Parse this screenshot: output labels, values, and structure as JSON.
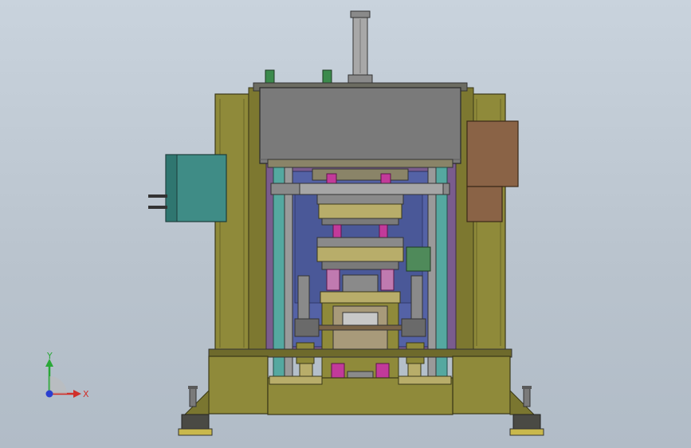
{
  "view": {
    "type": "cad-3d-viewport",
    "subject": "machine-assembly",
    "background_color": "#c0cad4"
  },
  "triad": {
    "x_label": "X",
    "y_label": "Y",
    "x_color": "#d0302b",
    "y_color": "#2aa838",
    "z_color": "#2b3fd0"
  },
  "colors": {
    "frame_olive": "#8f8a3a",
    "frame_olive_dark": "#5e5a22",
    "top_plate_grey": "#7a7a7a",
    "back_panel_purple": "#7a5c8e",
    "back_panel_blue": "#5462a6",
    "teal_box": "#3f8c86",
    "brown_box": "#8a6346",
    "magenta_part": "#c23a9a",
    "cylinder_grey": "#a7a7a7",
    "column_teal": "#55a8a0",
    "khaki_plate": "#b8ad6a",
    "green_knob": "#3c8a4c",
    "foot_dark": "#4a4a44",
    "foot_yellow": "#c9b84c"
  }
}
